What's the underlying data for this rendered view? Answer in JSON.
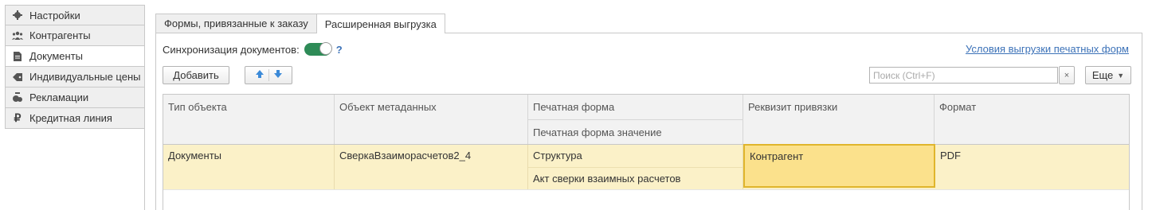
{
  "sidebar": {
    "items": [
      {
        "label": "Настройки",
        "icon": "gear-icon"
      },
      {
        "label": "Контрагенты",
        "icon": "users-icon"
      },
      {
        "label": "Документы",
        "icon": "document-icon"
      },
      {
        "label": "Индивидуальные цены",
        "icon": "price-tag-icon"
      },
      {
        "label": "Рекламации",
        "icon": "complaint-icon"
      },
      {
        "label": "Кредитная линия",
        "icon": "ruble-icon"
      }
    ],
    "active_index": 2
  },
  "tabs": [
    {
      "label": "Формы, привязанные к заказу"
    },
    {
      "label": "Расширенная выгрузка"
    }
  ],
  "sync": {
    "label": "Синхронизация документов:",
    "enabled": true,
    "help": "?"
  },
  "link": "Условия выгрузки печатных форм",
  "toolbar": {
    "add_label": "Добавить",
    "search_placeholder": "Поиск (Ctrl+F)",
    "clear_label": "×",
    "more_label": "Еще"
  },
  "table": {
    "headers": {
      "object_type": "Тип объекта",
      "metadata_object": "Объект метаданных",
      "print_form": "Печатная форма",
      "print_form_value": "Печатная форма значение",
      "binding_attr": "Реквизит привязки",
      "format": "Формат"
    },
    "rows": [
      {
        "object_type": "Документы",
        "metadata_object": "СверкаВзаиморасчетов2_4",
        "print_form": "Структура",
        "print_form_value": "Акт сверки взаимных расчетов",
        "binding_attr": "Контрагент",
        "format": "PDF"
      }
    ]
  },
  "colors": {
    "accent": "#3c72b8",
    "toggle_on": "#2e8b57",
    "row_selected": "#fbf1c8",
    "cell_focused": "#fbe18c"
  }
}
